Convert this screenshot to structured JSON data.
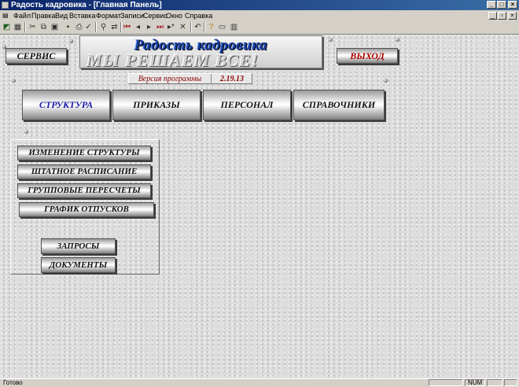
{
  "window": {
    "title": "Радость кадровика - [Главная Панель]"
  },
  "menu": [
    {
      "label": "Файл"
    },
    {
      "label": "Правка"
    },
    {
      "label": "Вид"
    },
    {
      "label": "Вставка"
    },
    {
      "label": "Формат"
    },
    {
      "label": "Записи"
    },
    {
      "label": "Сервис"
    },
    {
      "label": "Окно"
    },
    {
      "label": "Справка"
    }
  ],
  "banner": {
    "title": "Радость кадровика",
    "slogan": "МЫ РЕШАЕМ ВСЕ!"
  },
  "buttons": {
    "service": "СЕРВИС",
    "exit": "ВЫХОД"
  },
  "version": {
    "label": "Версия программы",
    "value": "2.19.13"
  },
  "tabs": [
    {
      "label": "СТРУКТУРА",
      "active": true
    },
    {
      "label": "ПРИКАЗЫ",
      "active": false
    },
    {
      "label": "ПЕРСОНАЛ",
      "active": false
    },
    {
      "label": "СПРАВОЧНИКИ",
      "active": false
    }
  ],
  "structure_buttons": [
    {
      "label": "ИЗМЕНЕНИЕ СТРУКТУРЫ"
    },
    {
      "label": "ШТАТНОЕ РАСПИСАНИЕ"
    },
    {
      "label": "ГРУППОВЫЕ ПЕРЕСЧЕТЫ"
    },
    {
      "label": "ГРАФИК ОТПУСКОВ"
    }
  ],
  "extra_buttons": [
    {
      "label": "ЗАПРОСЫ"
    },
    {
      "label": "ДОКУМЕНТЫ"
    }
  ],
  "status": {
    "text": "Готово",
    "num": "NUM"
  },
  "colors": {
    "title_bar": "#0a246a",
    "active_tab_text": "#1a1aa8",
    "exit_text": "#b00000",
    "version_text": "#8b0000"
  }
}
